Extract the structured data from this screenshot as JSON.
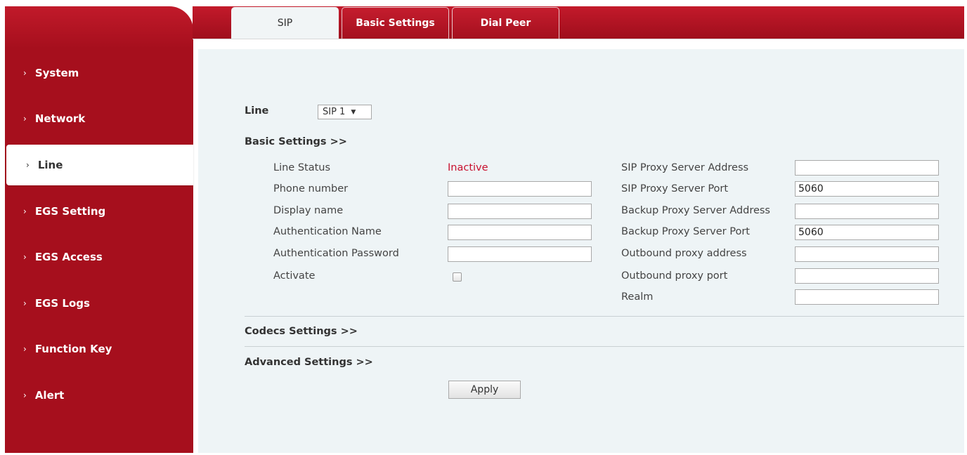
{
  "tabs": [
    {
      "label": "SIP",
      "active": true
    },
    {
      "label": "Basic Settings",
      "active": false
    },
    {
      "label": "Dial Peer",
      "active": false
    }
  ],
  "sidebar": {
    "chevron": "›",
    "items": [
      {
        "label": "System"
      },
      {
        "label": "Network"
      },
      {
        "label": "Line",
        "active": true
      },
      {
        "label": "EGS Setting"
      },
      {
        "label": "EGS Access"
      },
      {
        "label": "EGS Logs"
      },
      {
        "label": "Function Key"
      },
      {
        "label": "Alert"
      }
    ]
  },
  "line": {
    "label": "Line",
    "selected": "SIP 1",
    "arrow": "▼"
  },
  "sections": {
    "basic": "Basic Settings >>",
    "codecs": "Codecs Settings >>",
    "advanced": "Advanced Settings >>"
  },
  "left_fields": {
    "line_status": {
      "label": "Line Status",
      "value": "Inactive"
    },
    "phone_number": {
      "label": "Phone number",
      "value": ""
    },
    "display_name": {
      "label": "Display name",
      "value": ""
    },
    "auth_name": {
      "label": "Authentication Name",
      "value": ""
    },
    "auth_password": {
      "label": "Authentication Password",
      "value": ""
    },
    "activate": {
      "label": "Activate",
      "checked": false
    }
  },
  "right_fields": {
    "proxy_address": {
      "label": "SIP Proxy Server Address",
      "value": ""
    },
    "proxy_port": {
      "label": "SIP Proxy Server Port",
      "value": "5060"
    },
    "backup_address": {
      "label": "Backup Proxy Server Address",
      "value": ""
    },
    "backup_port": {
      "label": "Backup Proxy Server Port",
      "value": "5060"
    },
    "outbound_address": {
      "label": "Outbound proxy address",
      "value": ""
    },
    "outbound_port": {
      "label": "Outbound proxy port",
      "value": ""
    },
    "realm": {
      "label": "Realm",
      "value": ""
    }
  },
  "apply_label": "Apply",
  "colors": {
    "brand": "#a60f1d",
    "status_inactive": "#c8102e",
    "content_bg": "#eef4f6"
  }
}
